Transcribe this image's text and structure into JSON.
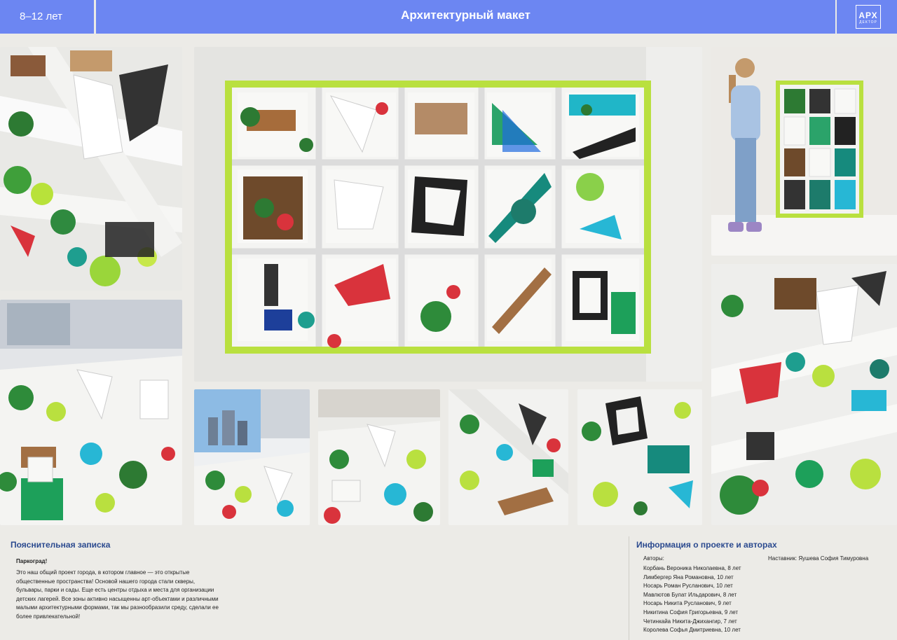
{
  "header": {
    "age": "8–12 лет",
    "title": "Архитектурный макет",
    "logo_main": "АРХ",
    "logo_sub": "ДЕКТОР"
  },
  "colors": {
    "header_blue": "#6c86f2",
    "heading_blue": "#2b4a8f",
    "background": "#ecebe7"
  },
  "photos": [
    {
      "name": "photo-model-closeup-left-top"
    },
    {
      "name": "photo-model-main-top-view"
    },
    {
      "name": "photo-girl-with-model"
    },
    {
      "name": "photo-model-angle-left-bottom"
    },
    {
      "name": "photo-model-window-view"
    },
    {
      "name": "photo-model-perspective-1"
    },
    {
      "name": "photo-model-perspective-2"
    },
    {
      "name": "photo-model-perspective-3"
    },
    {
      "name": "photo-model-closeup-right"
    }
  ],
  "note": {
    "heading": "Пояснительная записка",
    "subtitle": "Паркоград!",
    "body": "Это наш общий проект города, в котором главное — это открытые общественные пространства! Основой нашего города стали скверы, бульвары, парки и сады. Еще есть центры отдыха и места для организации детских лагерей. Все зоны активно насыщенны арт-объектами и различными малыми архитектурными формами, так мы разнообразили среду, сделали ее более привлекательной!"
  },
  "info": {
    "heading": "Информация о проекте и авторах",
    "authors_label": "Авторы:",
    "authors": [
      "Корбань Вероника Николаевна, 8 лет",
      "Лимбергер Яна Романовна, 10 лет",
      "Носарь Роман Русланович, 10 лет",
      "Мавлютов Булат Ильдарович, 8 лет",
      "Носарь Никита Русланович, 9 лет",
      "Никитина София Григорьевна, 9 лет",
      "Четинкайа Никита-Джихангир, 7 лет",
      "Королева Софья Дмитриевна, 10 лет"
    ],
    "mentor": "Наставник: Яушева София Тимуровна"
  }
}
